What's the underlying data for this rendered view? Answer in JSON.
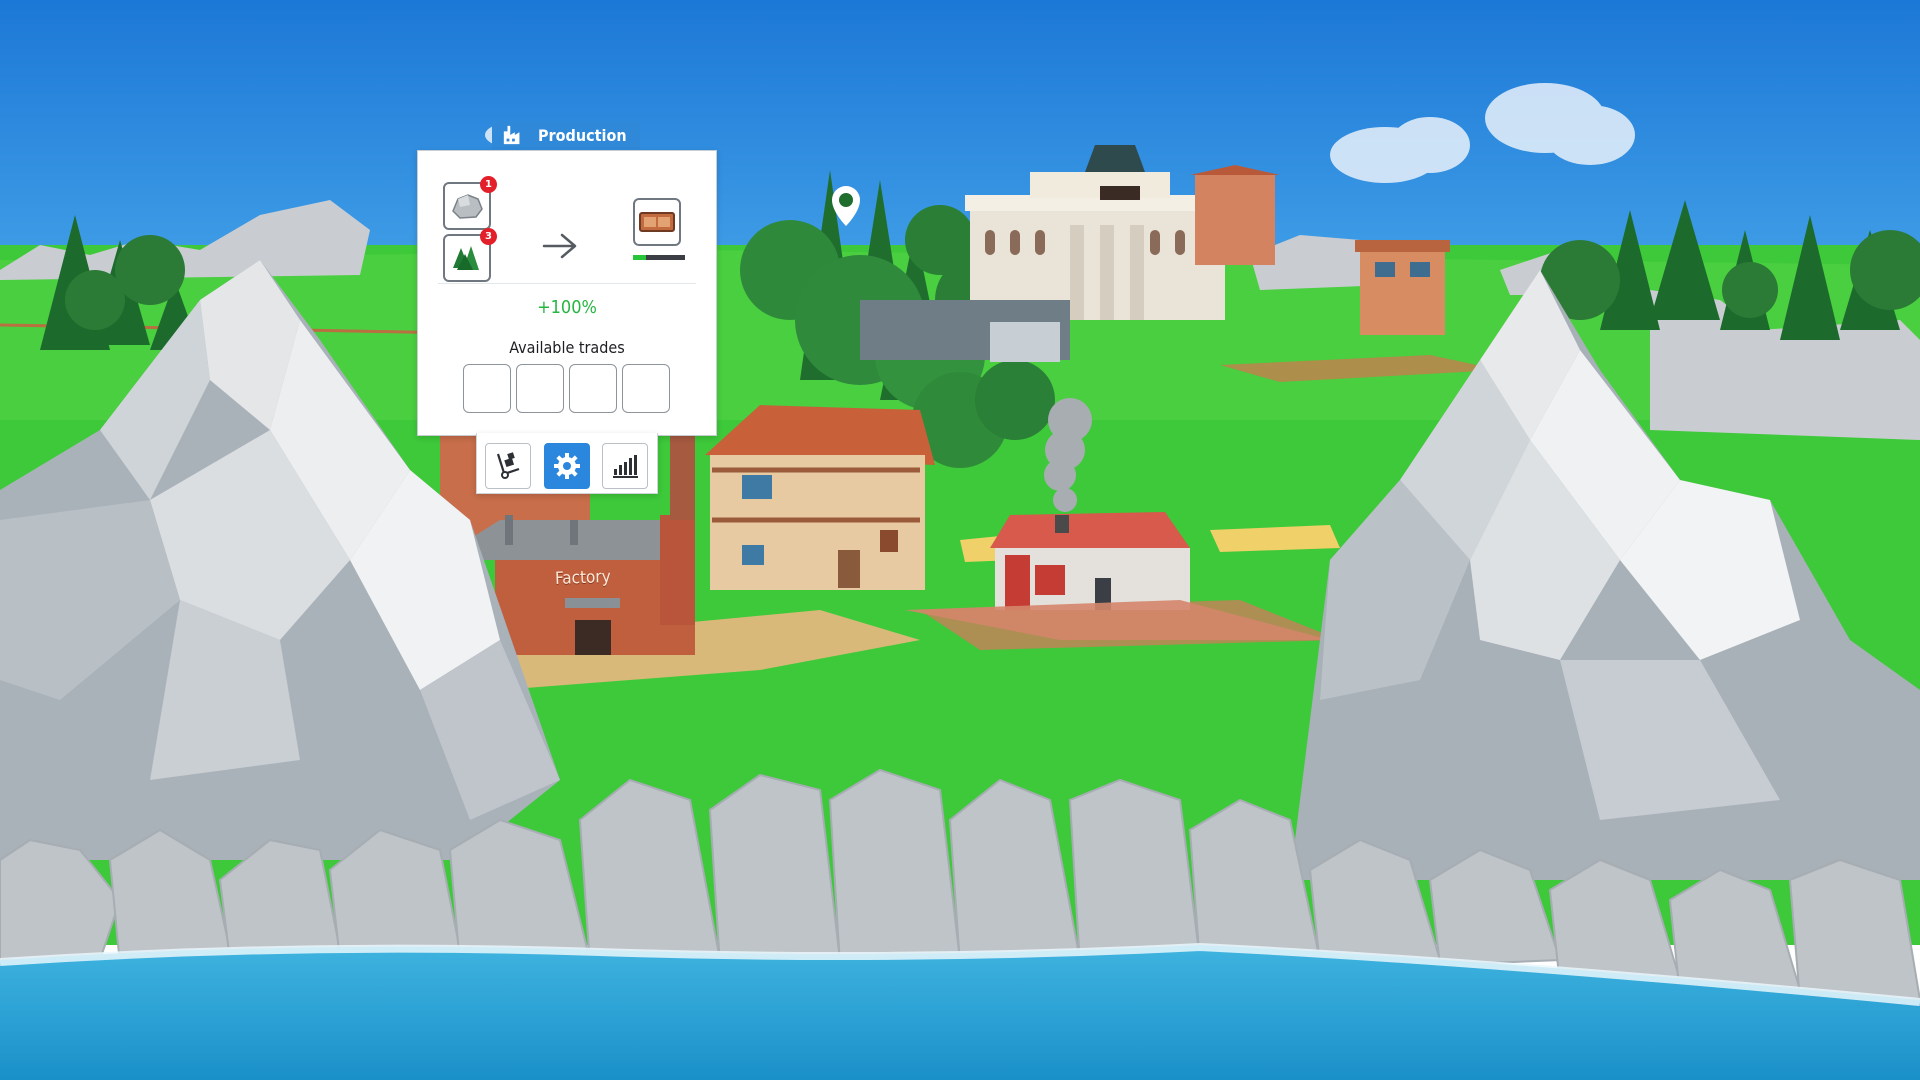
{
  "window": {
    "title": ""
  },
  "production_panel": {
    "tab_label": "Production",
    "inputs": [
      {
        "icon": "stone-icon",
        "count": "1"
      },
      {
        "icon": "wood-icon",
        "count": "3"
      }
    ],
    "output": {
      "icon": "furniture-icon",
      "progress": 0.25
    },
    "efficiency": "+100%",
    "available_trades_label": "Available trades",
    "trade_slots": 4
  },
  "toolbar": {
    "buttons": [
      {
        "name": "logistics-button",
        "icon": "hand-truck-icon",
        "active": false
      },
      {
        "name": "production-button",
        "icon": "gear-icon",
        "active": true
      },
      {
        "name": "statistics-button",
        "icon": "bar-chart-icon",
        "active": false
      }
    ]
  },
  "world": {
    "factory_sign": "Factory"
  },
  "colors": {
    "accent": "#2b86dd",
    "badge": "#e3202a",
    "efficiency_text": "#25b540",
    "progress_fill": "#27c63a"
  }
}
